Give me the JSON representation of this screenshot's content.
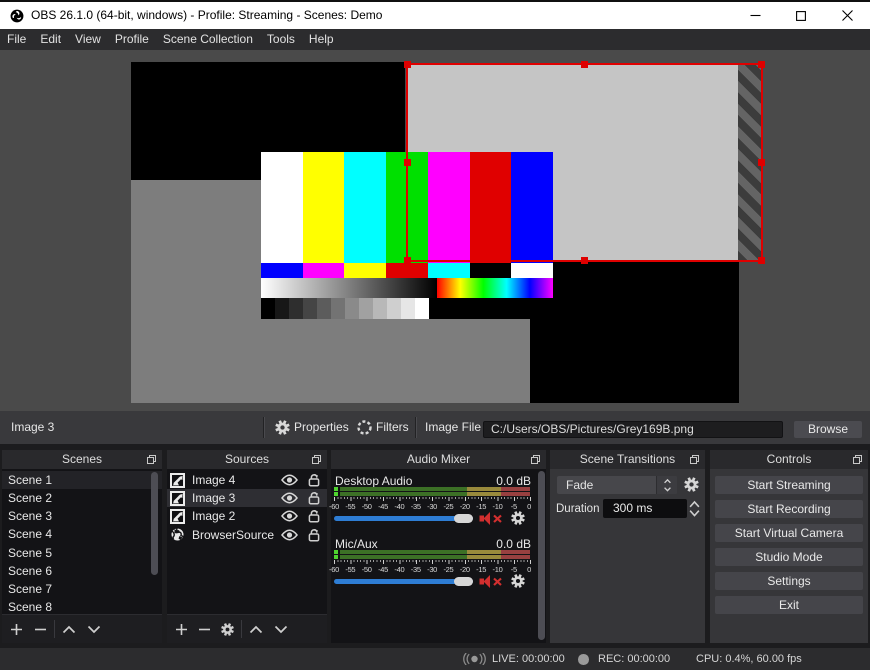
{
  "window": {
    "title": "OBS 26.1.0 (64-bit, windows) - Profile: Streaming - Scenes: Demo",
    "controls": [
      "minimize-icon",
      "maximize-icon",
      "close-icon"
    ]
  },
  "menu": {
    "items": [
      "File",
      "Edit",
      "View",
      "Profile",
      "Scene Collection",
      "Tools",
      "Help"
    ]
  },
  "source_toolbar": {
    "selected_source": "Image 3",
    "properties_label": "Properties",
    "filters_label": "Filters",
    "image_file_label": "Image File",
    "image_file_value": "C:/Users/OBS/Pictures/Grey169B.png",
    "browse_label": "Browse"
  },
  "docks": {
    "scenes": {
      "title": "Scenes",
      "items": [
        "Scene 1",
        "Scene 2",
        "Scene 3",
        "Scene 4",
        "Scene 5",
        "Scene 6",
        "Scene 7",
        "Scene 8"
      ],
      "selected": "Scene 1"
    },
    "sources": {
      "title": "Sources",
      "items": [
        {
          "name": "Image 4",
          "type": "image"
        },
        {
          "name": "Image 3",
          "type": "image",
          "selected": true
        },
        {
          "name": "Image 2",
          "type": "image"
        },
        {
          "name": "BrowserSource",
          "type": "browser"
        }
      ]
    },
    "audio_mixer": {
      "title": "Audio Mixer",
      "channels": [
        {
          "name": "Desktop Audio",
          "volume": "0.0 dB",
          "muted": true
        },
        {
          "name": "Mic/Aux",
          "volume": "0.0 dB",
          "muted": true
        }
      ],
      "scale_labels": [
        "-60",
        "-55",
        "-50",
        "-45",
        "-40",
        "-35",
        "-30",
        "-25",
        "-20",
        "-15",
        "-10",
        "-5",
        "0"
      ]
    },
    "transitions": {
      "title": "Scene Transitions",
      "transition": "Fade",
      "duration_label": "Duration",
      "duration_value": "300 ms"
    },
    "controls": {
      "title": "Controls",
      "buttons": [
        "Start Streaming",
        "Start Recording",
        "Start Virtual Camera",
        "Studio Mode",
        "Settings",
        "Exit"
      ]
    }
  },
  "statusbar": {
    "live": "LIVE: 00:00:00",
    "rec": "REC: 00:00:00",
    "cpu": "CPU: 0.4%, 60.00 fps"
  },
  "colors": {
    "accent_blue": "#2e7dd4",
    "selection_red": "#df0000",
    "meter_green": "#3f7c2b",
    "meter_yellow": "#9c8d3d",
    "meter_red": "#9a4343",
    "meter_level_green": "#4fd32f",
    "mute_red": "#d22f2f"
  },
  "smpte": {
    "bars": [
      "#ffffff",
      "#ffff00",
      "#00ffff",
      "#00e000",
      "#ff00ff",
      "#e00000",
      "#0000ff"
    ],
    "castellations": [
      "#0000ff",
      "#ff00ff",
      "#ffff00",
      "#e00000",
      "#00ffff",
      "#000000",
      "#ffffff"
    ],
    "steps": [
      "#000000",
      "#171717",
      "#2e2e2e",
      "#454545",
      "#5c5c5c",
      "#737373",
      "#8a8a8a",
      "#a1a1a1",
      "#b8b8b8",
      "#cfcfcf",
      "#e6e6e6",
      "#ffffff"
    ]
  }
}
